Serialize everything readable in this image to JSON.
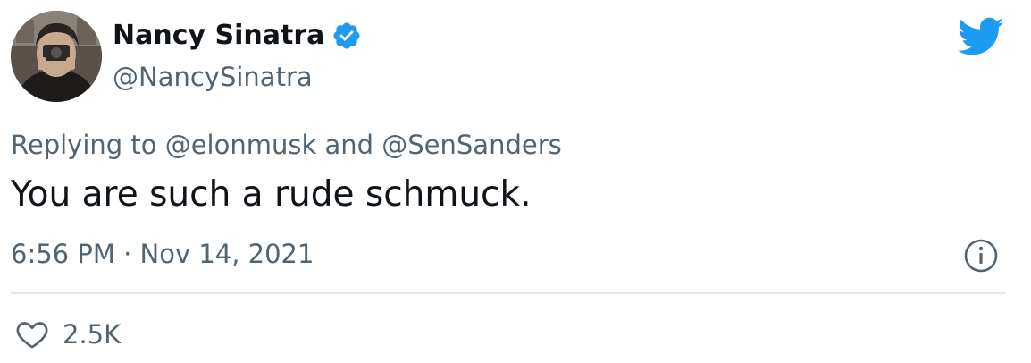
{
  "author": {
    "display_name": "Nancy Sinatra",
    "handle": "@NancySinatra",
    "verified": true,
    "avatar_icon": "profile-photo"
  },
  "tweet": {
    "replying_to": "Replying to @elonmusk and @SenSanders",
    "text": "You are such a rude schmuck.",
    "timestamp": "6:56 PM · Nov 14, 2021"
  },
  "actions": {
    "like_count": "2.5K",
    "like_icon": "heart-icon",
    "info_icon": "info-icon"
  },
  "brand": {
    "icon": "twitter-bird-icon",
    "color": "#1d9bf0"
  },
  "colors": {
    "text_primary": "#0f1419",
    "text_secondary": "#536471",
    "divider": "#e1e8ed",
    "verified": "#1d9bf0"
  }
}
